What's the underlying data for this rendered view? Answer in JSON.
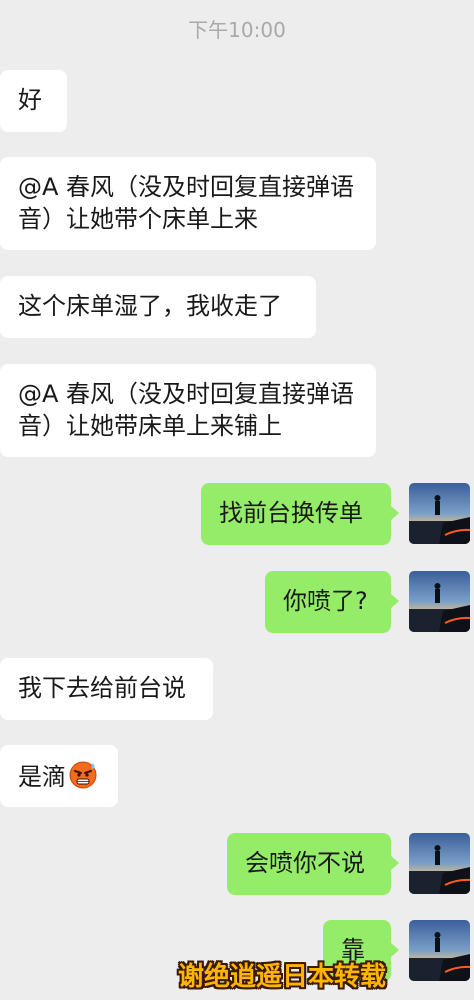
{
  "timestamp": "下午10:00",
  "messages": [
    {
      "side": "in",
      "lines": [
        "好"
      ]
    },
    {
      "side": "in",
      "lines": [
        "@A 春风（没及时回复直接弹语",
        "音）让她带个床单上来"
      ]
    },
    {
      "side": "in",
      "lines": [
        "这个床单湿了，我收走了"
      ]
    },
    {
      "side": "in",
      "lines": [
        "@A 春风（没及时回复直接弹语",
        "音）让她带床单上来铺上"
      ]
    },
    {
      "side": "out",
      "lines": [
        "找前台换传单"
      ]
    },
    {
      "side": "out",
      "lines": [
        "你喷了?"
      ]
    },
    {
      "side": "in",
      "lines": [
        "我下去给前台说"
      ]
    },
    {
      "side": "in",
      "lines": [
        "是滴"
      ],
      "emoji": "angry-sweat-emoji-icon"
    },
    {
      "side": "out",
      "lines": [
        "会喷你不说"
      ]
    },
    {
      "side": "out",
      "lines": [
        "靠"
      ]
    }
  ],
  "watermark": "谢绝逍遥日本转载",
  "colors": {
    "background": "#ededed",
    "incoming_bubble": "#ffffff",
    "outgoing_bubble": "#95ec69",
    "timestamp_text": "#a9a9a9",
    "watermark_fill": "#ffb400"
  }
}
